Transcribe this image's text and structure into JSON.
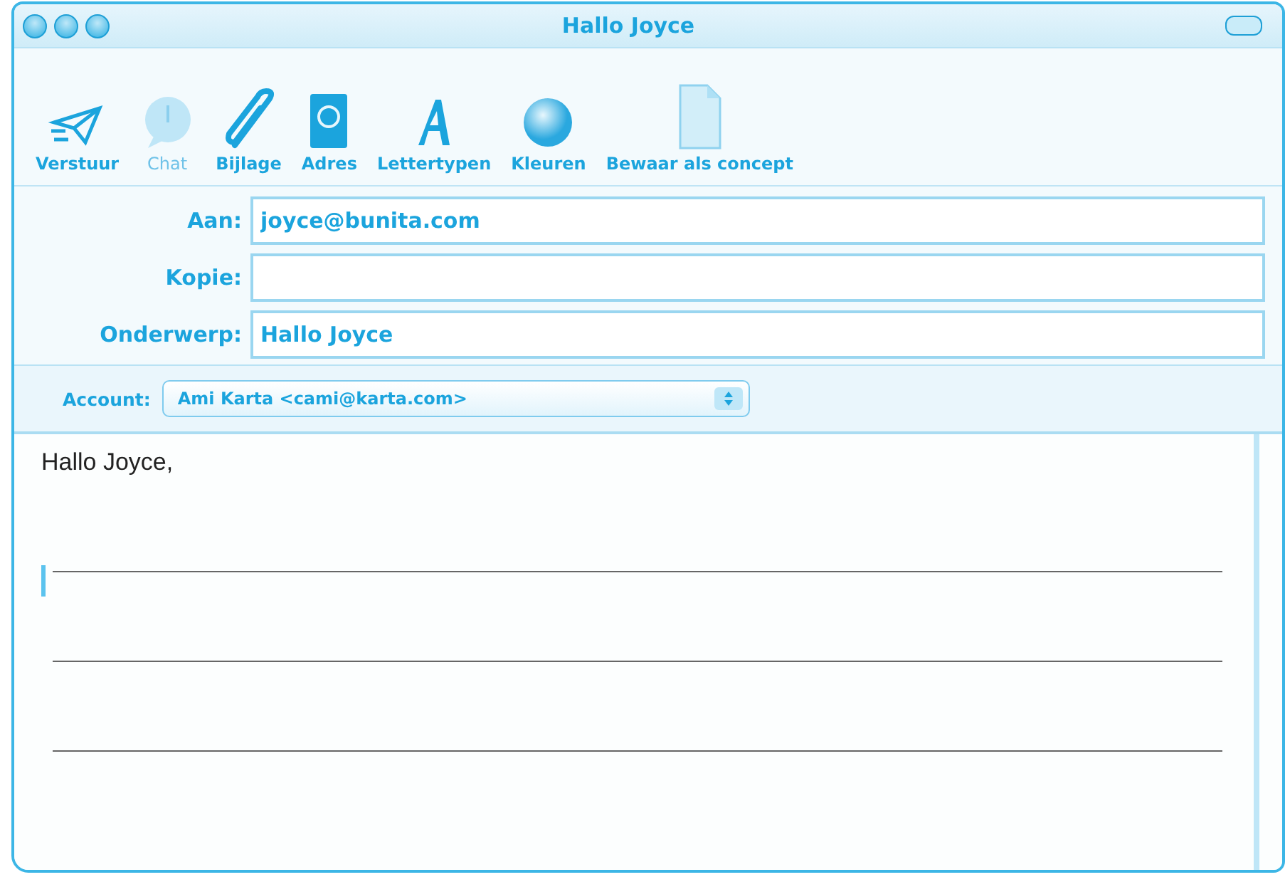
{
  "window": {
    "title": "Hallo Joyce"
  },
  "toolbar": [
    {
      "kind": "send",
      "label": "Verstuur",
      "disabled": false
    },
    {
      "kind": "chat",
      "label": "Chat",
      "disabled": true
    },
    {
      "kind": "attach",
      "label": "Bijlage",
      "disabled": false
    },
    {
      "kind": "address",
      "label": "Adres",
      "disabled": false
    },
    {
      "kind": "fonts",
      "label": "Lettertypen",
      "disabled": false
    },
    {
      "kind": "colors",
      "label": "Kleuren",
      "disabled": false
    },
    {
      "kind": "draft",
      "label": "Bewaar als concept",
      "disabled": false
    }
  ],
  "fields": [
    {
      "label": "Aan:",
      "value": "joyce@bunita.com"
    },
    {
      "label": "Kopie:"
    },
    {
      "label": "Onderwerp:",
      "value": "Hallo Joyce"
    }
  ],
  "account": {
    "label": "Account:",
    "value": "Ami Karta <cami@karta.com>"
  },
  "body": {
    "text": "Hallo Joyce,",
    "cursor": true,
    "lines": [
      {
        "kind": "fill-in"
      },
      {
        "kind": "fill-in"
      },
      {
        "kind": "fill-in"
      }
    ]
  }
}
